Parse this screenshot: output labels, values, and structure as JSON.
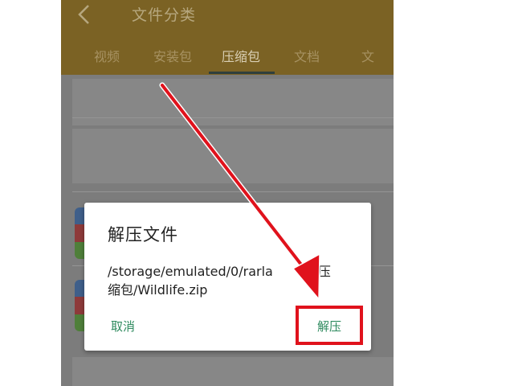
{
  "header": {
    "title": "文件分类",
    "back_icon": "chevron-left-icon"
  },
  "tabs": [
    {
      "label": "视频",
      "active": false
    },
    {
      "label": "安装包",
      "active": false
    },
    {
      "label": "压缩包",
      "active": true
    },
    {
      "label": "文档",
      "active": false
    },
    {
      "label": "文",
      "active": false
    }
  ],
  "dialog": {
    "title": "解压文件",
    "path": "/storage/emulated/0/rarla... 的压缩包/Wildlife.zip",
    "path_line1": "/storage/emulated/0/rarla",
    "path_line1_tail": "的压",
    "path_line2": "缩包/Wildlife.zip",
    "cancel_label": "取消",
    "extract_label": "解压"
  },
  "colors": {
    "header": "#7b6224",
    "accent": "#2e8a5e",
    "annotation": "#e0121c"
  }
}
